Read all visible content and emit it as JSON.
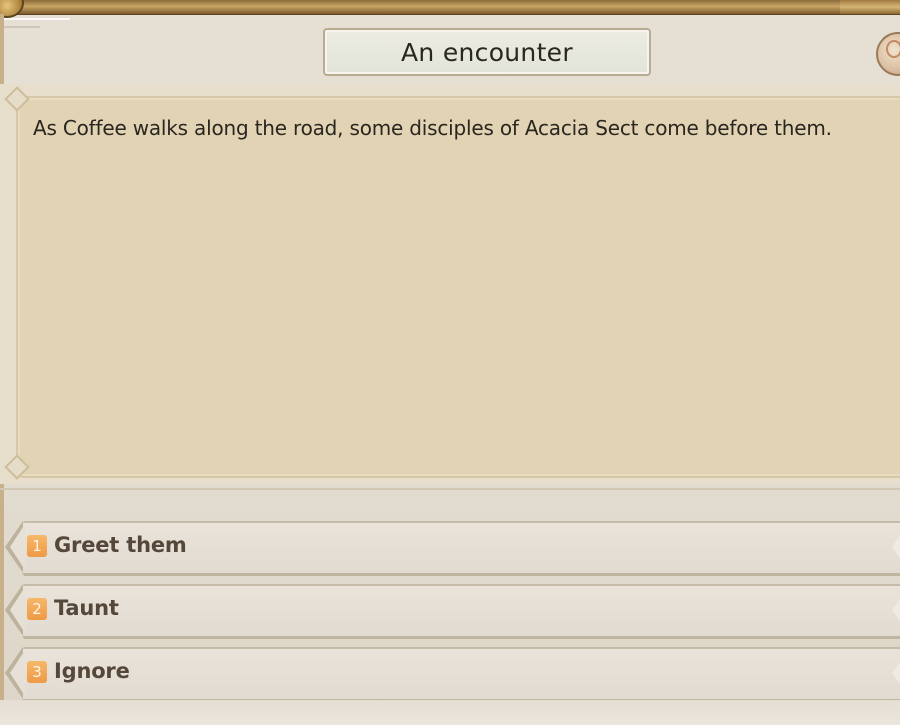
{
  "dialog": {
    "title": "An encounter",
    "description": "As Coffee walks along the road, some disciples of Acacia Sect come before them."
  },
  "options": [
    {
      "number": "1",
      "label": "Greet them"
    },
    {
      "number": "2",
      "label": "Taunt"
    },
    {
      "number": "3",
      "label": "Ignore"
    }
  ],
  "colors": {
    "panel": "#e1d3b3",
    "option_badge": "#f0a24c",
    "option_text": "#55483a",
    "gold_trim": "#c9a665"
  },
  "icons": {
    "avatar": "character-portrait-icon",
    "corner": "gold-orb-ornament-icon"
  }
}
